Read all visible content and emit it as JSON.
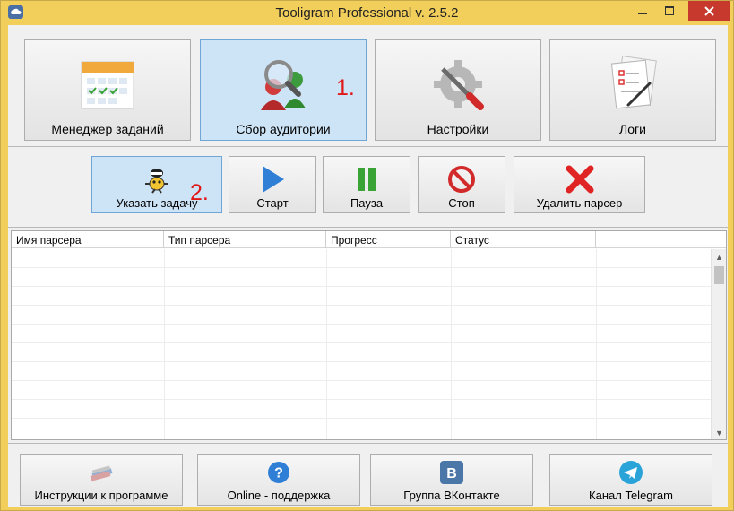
{
  "window": {
    "title": "Tooligram Professional v. 2.5.2"
  },
  "main_tabs": [
    {
      "label": "Менеджер заданий",
      "icon": "calendar-icon"
    },
    {
      "label": "Сбор аудитории",
      "icon": "people-search-icon",
      "active": true
    },
    {
      "label": "Настройки",
      "icon": "gear-tools-icon"
    },
    {
      "label": "Логи",
      "icon": "log-pages-icon"
    }
  ],
  "toolbar": [
    {
      "label": "Указать задачу",
      "icon": "robot-task-icon",
      "active": true
    },
    {
      "label": "Старт",
      "icon": "play-icon"
    },
    {
      "label": "Пауза",
      "icon": "pause-icon"
    },
    {
      "label": "Стоп",
      "icon": "stop-icon"
    },
    {
      "label": "Удалить парсер",
      "icon": "delete-x-icon"
    }
  ],
  "annotations": [
    "1.",
    "2."
  ],
  "table": {
    "columns": [
      "Имя парсера",
      "Тип парсера",
      "Прогресс",
      "Статус"
    ],
    "rows": []
  },
  "footer": [
    {
      "label": "Инструкции к программе",
      "icon": "books-icon"
    },
    {
      "label": "Online - поддержка",
      "icon": "help-icon"
    },
    {
      "label": "Группа ВКонтакте",
      "icon": "vk-icon"
    },
    {
      "label": "Канал Telegram",
      "icon": "telegram-icon"
    }
  ],
  "colors": {
    "title_bar": "#f2ce5b",
    "close_button": "#c7382d",
    "active_button": "#cde4f7",
    "annotation": "#e01818"
  }
}
